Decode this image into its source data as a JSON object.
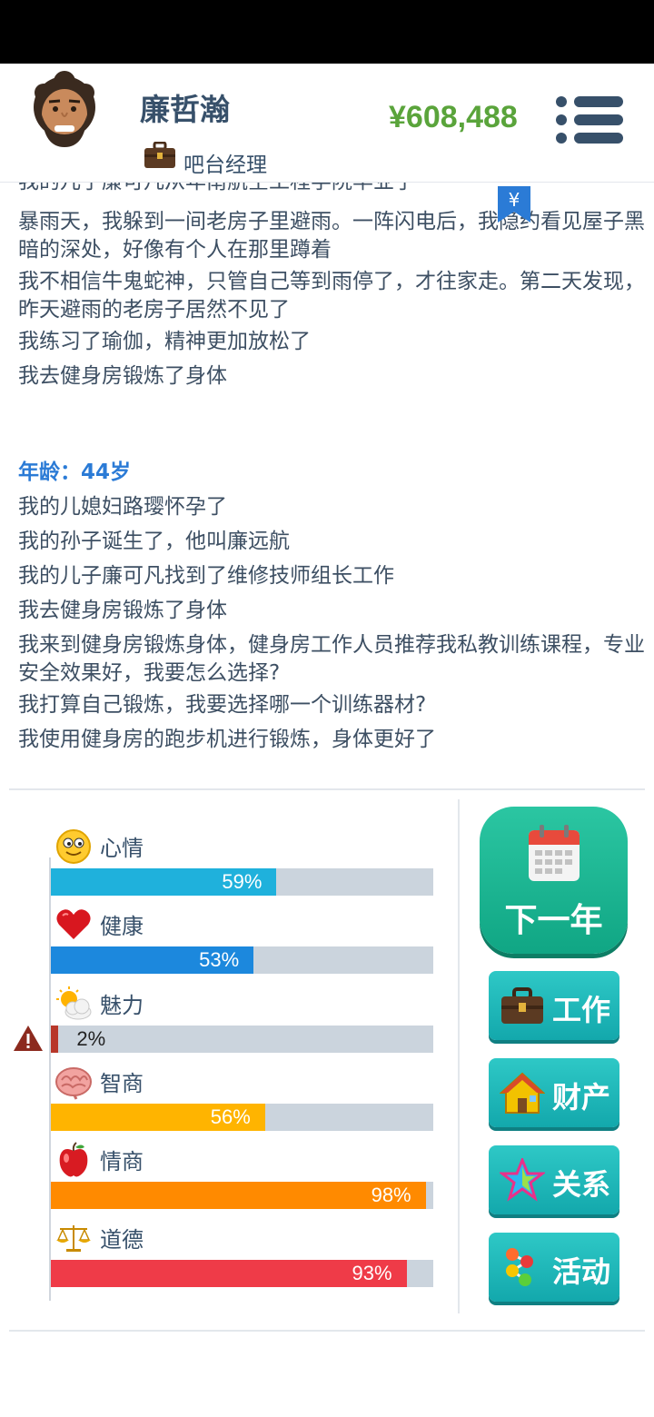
{
  "player": {
    "name": "廉哲瀚",
    "job": "吧台经理",
    "money": "¥608,488"
  },
  "log": {
    "clipped_line": "我的儿子廉可凡从年南航空工程学院毕业了",
    "badge_symbol": "¥",
    "lines_before": [
      "暴雨天，我躲到一间老房子里避雨。一阵闪电后，我隐约看见屋子黑暗的深处，好像有个人在那里蹲着",
      "我不相信牛鬼蛇神，只管自己等到雨停了，才往家走。第二天发现，昨天避雨的老房子居然不见了",
      "我练习了瑜伽，精神更加放松了",
      "我去健身房锻炼了身体"
    ],
    "age_heading": "年龄：44岁",
    "lines_after": [
      "我的儿媳妇路璎怀孕了",
      "我的孙子诞生了，他叫廉远航",
      "我的儿子廉可凡找到了维修技师组长工作",
      "我去健身房锻炼了身体",
      "我来到健身房锻炼身体，健身房工作人员推荐我私教训练课程，专业安全效果好，我要怎么选择?",
      "我打算自己锻炼，我要选择哪一个训练器材?",
      "我使用健身房的跑步机进行锻炼，身体更好了"
    ]
  },
  "stats": [
    {
      "label": "心情",
      "value": 0.59,
      "text": "59%",
      "color": "#1fb1dc",
      "icon": "smiley-icon"
    },
    {
      "label": "健康",
      "value": 0.53,
      "text": "53%",
      "color": "#1c88dd",
      "icon": "heart-icon"
    },
    {
      "label": "魅力",
      "value": 0.02,
      "text": "2%",
      "color": "#b8372a",
      "icon": "sun-cloud-icon",
      "warning": true
    },
    {
      "label": "智商",
      "value": 0.56,
      "text": "56%",
      "color": "#ffb400",
      "icon": "brain-icon"
    },
    {
      "label": "情商",
      "value": 0.98,
      "text": "98%",
      "color": "#ff8a00",
      "icon": "apple-icon"
    },
    {
      "label": "道德",
      "value": 0.93,
      "text": "93%",
      "color": "#ef3b48",
      "icon": "scales-icon"
    }
  ],
  "actions": {
    "next_year": "下一年",
    "work": "工作",
    "assets": "财产",
    "relations": "关系",
    "activities": "活动"
  },
  "colors": {
    "money": "#5aa43b",
    "age_heading": "#2b7bd6",
    "next_year_button": "#19b48f",
    "nav_button": "#1fb8b9"
  }
}
